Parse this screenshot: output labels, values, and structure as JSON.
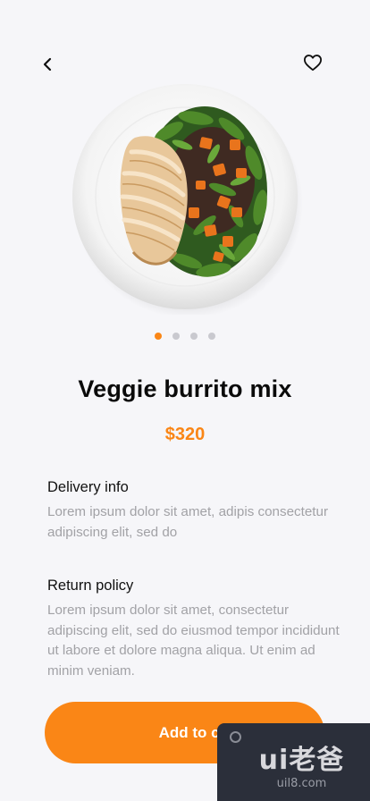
{
  "header": {
    "back_icon": "chevron-left-icon",
    "favorite_icon": "heart-outline-icon"
  },
  "product": {
    "image": "salad-plate-with-grilled-chicken",
    "title": "Veggie burrito mix",
    "price": "$320"
  },
  "carousel": {
    "count": 4,
    "active_index": 0
  },
  "sections": [
    {
      "title": "Delivery info",
      "body": "Lorem ipsum dolor sit amet, adipis consectetur adipiscing elit, sed do"
    },
    {
      "title": "Return policy",
      "body": "Lorem ipsum dolor sit amet, consectetur adipiscing elit, sed do eiusmod tempor incididunt ut labore et dolore magna aliqua. Ut enim ad minim veniam."
    }
  ],
  "cta": {
    "label": "Add to cart"
  },
  "watermark": {
    "logo": "ui老爸",
    "url": "uil8.com"
  },
  "colors": {
    "accent": "#fa8616",
    "background": "#f6f6f9",
    "body_text": "#a2a2a6"
  }
}
